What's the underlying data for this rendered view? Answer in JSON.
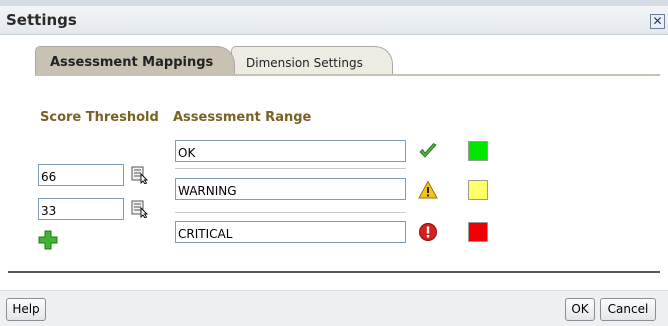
{
  "dialog": {
    "title": "Settings",
    "close_label": "✕"
  },
  "tabs": [
    {
      "label": "Assessment Mappings",
      "active": true
    },
    {
      "label": "Dimension Settings",
      "active": false
    }
  ],
  "columns": {
    "score_threshold": "Score Threshold",
    "assessment_range": "Assessment Range"
  },
  "thresholds": [
    {
      "value": "66"
    },
    {
      "value": "33"
    }
  ],
  "ranges": [
    {
      "label": "OK",
      "icon": "checkmark-icon",
      "color": "#00e600"
    },
    {
      "label": "WARNING",
      "icon": "warning-icon",
      "color": "#ffff66"
    },
    {
      "label": "CRITICAL",
      "icon": "critical-icon",
      "color": "#ee0000"
    }
  ],
  "buttons": {
    "help": "Help",
    "ok": "OK",
    "cancel": "Cancel"
  }
}
